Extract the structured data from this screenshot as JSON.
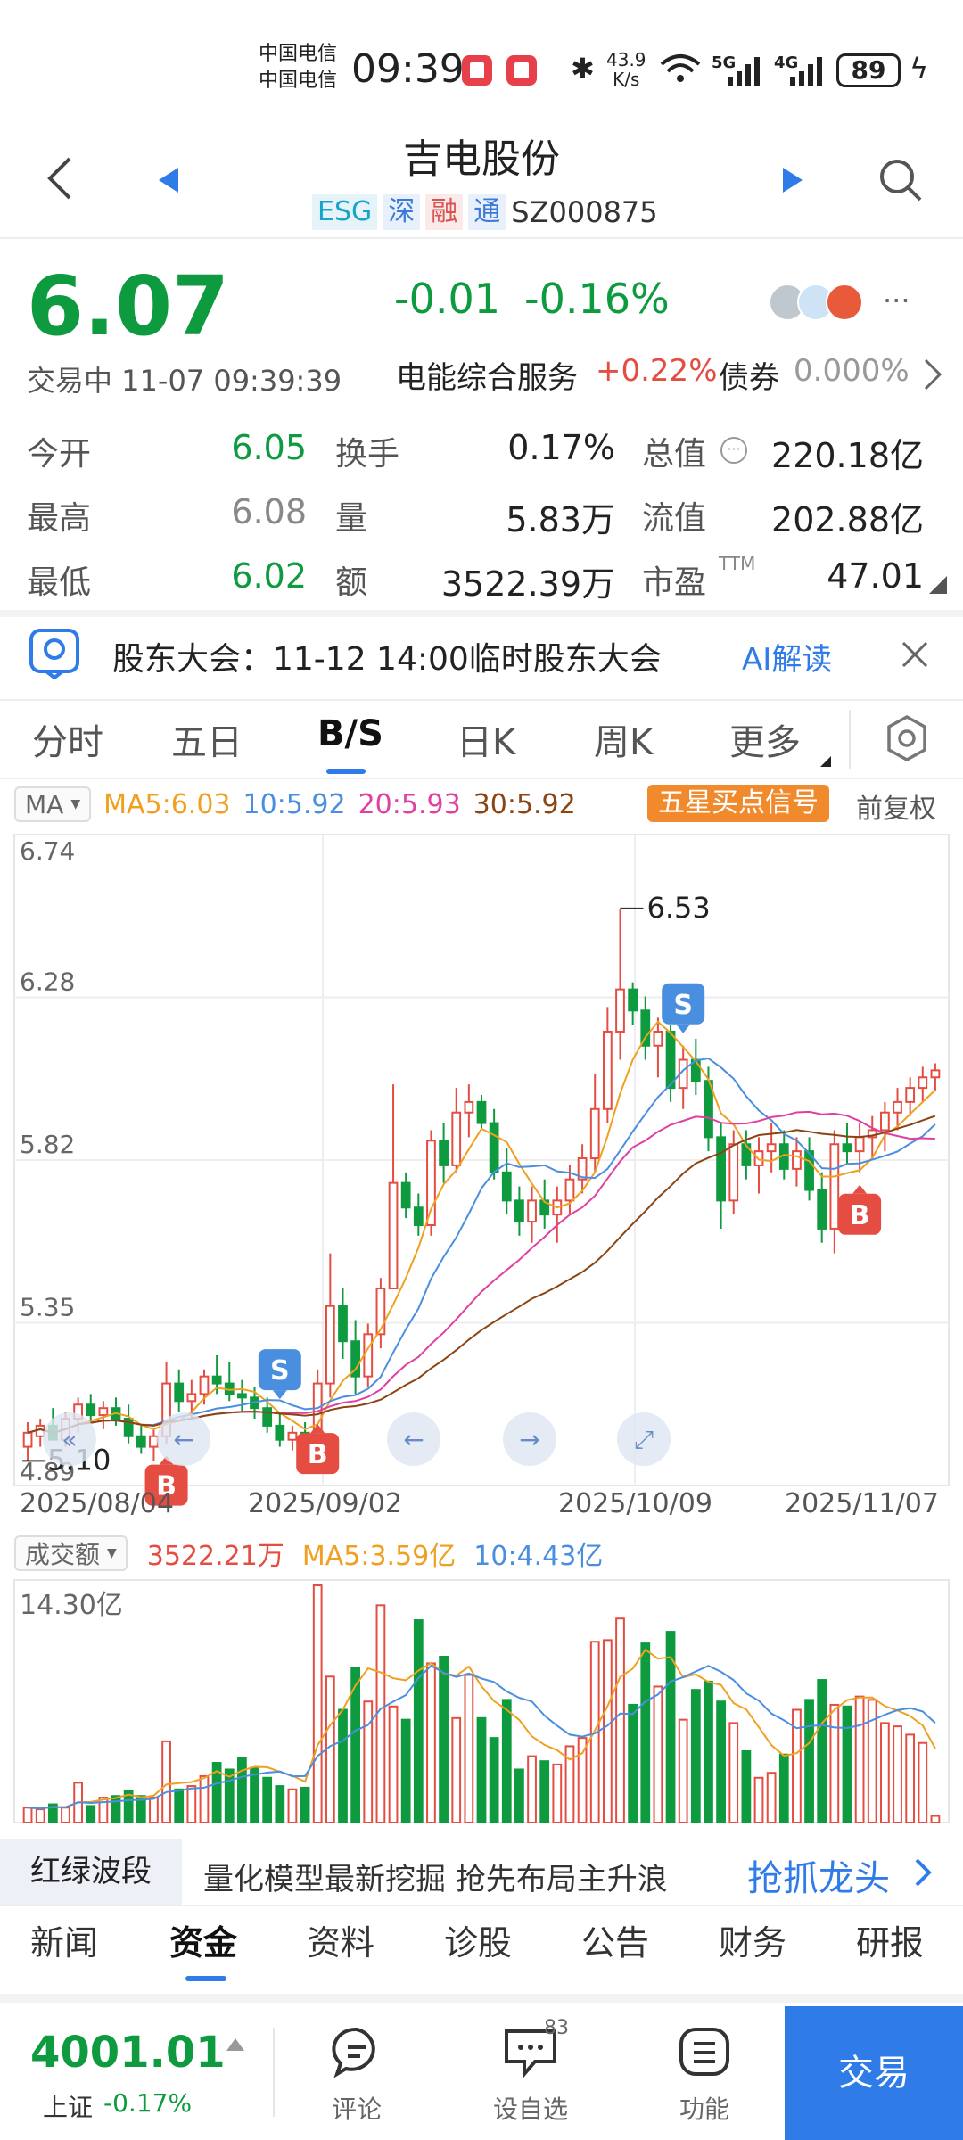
{
  "status": {
    "carrier1": "中国电信",
    "carrier2": "中国电信",
    "time": "09:39",
    "speed_value": "43.9",
    "speed_unit": "K/s",
    "net1": "5G",
    "net2": "4G",
    "battery": "89"
  },
  "header": {
    "title": "吉电股份",
    "tags": [
      "ESG",
      "深",
      "融",
      "通"
    ],
    "code": "SZ000875"
  },
  "quote": {
    "price": "6.07",
    "change": "-0.01",
    "change_pct": "-0.16%",
    "status_time": "交易中 11-07 09:39:39",
    "sector_name": "电能综合服务",
    "sector_pct": "+0.22%",
    "bond_label": "债券",
    "bond_pct": "0.000%",
    "more": "···"
  },
  "stats": [
    {
      "label": "今开",
      "value": "6.05",
      "color": "#0e9b3f"
    },
    {
      "label": "最高",
      "value": "6.08",
      "color": "#888888"
    },
    {
      "label": "最低",
      "value": "6.02",
      "color": "#0e9b3f"
    },
    {
      "label": "换手",
      "value": "0.17%",
      "color": "#222222"
    },
    {
      "label": "量",
      "value": "5.83万",
      "color": "#222222"
    },
    {
      "label": "额",
      "value": "3522.39万",
      "color": "#222222"
    },
    {
      "label": "总值",
      "value": "220.18亿",
      "color": "#222222"
    },
    {
      "label": "流值",
      "value": "202.88亿",
      "color": "#222222"
    },
    {
      "label": "市盈",
      "value": "47.01",
      "color": "#222222"
    }
  ],
  "pe_suffix": "TTM",
  "notice": {
    "text": "股东大会：11-12 14:00临时股东大会",
    "ai_label": "AI解读"
  },
  "chart_tabs": [
    "分时",
    "五日",
    "B/S",
    "日K",
    "周K",
    "更多"
  ],
  "ma_legend": {
    "selector": "MA",
    "ma5": "MA5:6.03",
    "ma10": "10:5.92",
    "ma20": "20:5.93",
    "ma30": "30:5.92",
    "signal_button": "五星买点信号",
    "adjust": "前复权"
  },
  "vol_legend": {
    "selector": "成交额",
    "value": "3522.21万",
    "ma5": "MA5:3.59亿",
    "ma10": "10:4.43亿",
    "max_label": "14.30亿"
  },
  "chart_data": {
    "type": "candlestick",
    "y_ticks": [
      "6.74",
      "6.28",
      "5.82",
      "5.35",
      "4.89"
    ],
    "ylim": [
      4.89,
      6.74
    ],
    "x_labels": [
      "2025/08/04",
      "2025/09/02",
      "2025/10/09",
      "2025/11/07"
    ],
    "annotations": {
      "high": "6.53",
      "low": "5.10"
    },
    "signals": [
      "B",
      "S",
      "B",
      "S",
      "B"
    ],
    "colors": {
      "up": "#e54d42",
      "down": "#0e9b3f",
      "ma5": "#f0a020",
      "ma10": "#4a8ee0",
      "ma20": "#e040a0",
      "ma30": "#8b4513"
    },
    "candles": [
      {
        "o": 5.0,
        "h": 5.07,
        "l": 4.96,
        "c": 5.04
      },
      {
        "o": 5.03,
        "h": 5.08,
        "l": 5.0,
        "c": 5.06
      },
      {
        "o": 5.06,
        "h": 5.11,
        "l": 5.02,
        "c": 5.02
      },
      {
        "o": 5.02,
        "h": 5.1,
        "l": 5.0,
        "c": 5.08
      },
      {
        "o": 5.08,
        "h": 5.14,
        "l": 5.04,
        "c": 5.12
      },
      {
        "o": 5.12,
        "h": 5.15,
        "l": 5.07,
        "c": 5.09
      },
      {
        "o": 5.09,
        "h": 5.13,
        "l": 5.05,
        "c": 5.11
      },
      {
        "o": 5.11,
        "h": 5.14,
        "l": 5.06,
        "c": 5.08
      },
      {
        "o": 5.08,
        "h": 5.12,
        "l": 5.01,
        "c": 5.03
      },
      {
        "o": 5.03,
        "h": 5.06,
        "l": 4.98,
        "c": 5.0
      },
      {
        "o": 5.0,
        "h": 5.05,
        "l": 4.96,
        "c": 5.03
      },
      {
        "o": 5.03,
        "h": 5.24,
        "l": 5.01,
        "c": 5.18
      },
      {
        "o": 5.18,
        "h": 5.22,
        "l": 5.1,
        "c": 5.13
      },
      {
        "o": 5.13,
        "h": 5.19,
        "l": 5.08,
        "c": 5.15
      },
      {
        "o": 5.15,
        "h": 5.22,
        "l": 5.12,
        "c": 5.2
      },
      {
        "o": 5.2,
        "h": 5.26,
        "l": 5.15,
        "c": 5.18
      },
      {
        "o": 5.18,
        "h": 5.24,
        "l": 5.13,
        "c": 5.15
      },
      {
        "o": 5.15,
        "h": 5.19,
        "l": 5.1,
        "c": 5.14
      },
      {
        "o": 5.14,
        "h": 5.17,
        "l": 5.08,
        "c": 5.11
      },
      {
        "o": 5.11,
        "h": 5.14,
        "l": 5.04,
        "c": 5.06
      },
      {
        "o": 5.06,
        "h": 5.1,
        "l": 5.0,
        "c": 5.02
      },
      {
        "o": 5.02,
        "h": 5.06,
        "l": 4.99,
        "c": 5.04
      },
      {
        "o": 5.04,
        "h": 5.07,
        "l": 5.0,
        "c": 5.02
      },
      {
        "o": 5.02,
        "h": 5.22,
        "l": 5.1,
        "c": 5.18
      },
      {
        "o": 5.18,
        "h": 5.55,
        "l": 5.14,
        "c": 5.4
      },
      {
        "o": 5.4,
        "h": 5.45,
        "l": 5.25,
        "c": 5.3
      },
      {
        "o": 5.3,
        "h": 5.36,
        "l": 5.15,
        "c": 5.2
      },
      {
        "o": 5.2,
        "h": 5.35,
        "l": 5.17,
        "c": 5.32
      },
      {
        "o": 5.32,
        "h": 5.48,
        "l": 5.28,
        "c": 5.45
      },
      {
        "o": 5.45,
        "h": 6.03,
        "l": 5.6,
        "c": 5.75
      },
      {
        "o": 5.75,
        "h": 5.78,
        "l": 5.65,
        "c": 5.68
      },
      {
        "o": 5.68,
        "h": 5.72,
        "l": 5.6,
        "c": 5.63
      },
      {
        "o": 5.63,
        "h": 5.9,
        "l": 5.6,
        "c": 5.87
      },
      {
        "o": 5.87,
        "h": 5.92,
        "l": 5.75,
        "c": 5.8
      },
      {
        "o": 5.8,
        "h": 6.02,
        "l": 5.78,
        "c": 5.95
      },
      {
        "o": 5.95,
        "h": 6.03,
        "l": 5.88,
        "c": 5.98
      },
      {
        "o": 5.98,
        "h": 6.0,
        "l": 5.9,
        "c": 5.92
      },
      {
        "o": 5.92,
        "h": 5.96,
        "l": 5.76,
        "c": 5.78
      },
      {
        "o": 5.78,
        "h": 5.85,
        "l": 5.66,
        "c": 5.7
      },
      {
        "o": 5.7,
        "h": 5.74,
        "l": 5.6,
        "c": 5.64
      },
      {
        "o": 5.64,
        "h": 5.74,
        "l": 5.58,
        "c": 5.7
      },
      {
        "o": 5.7,
        "h": 5.76,
        "l": 5.62,
        "c": 5.66
      },
      {
        "o": 5.66,
        "h": 5.74,
        "l": 5.58,
        "c": 5.7
      },
      {
        "o": 5.7,
        "h": 5.8,
        "l": 5.66,
        "c": 5.76
      },
      {
        "o": 5.76,
        "h": 5.86,
        "l": 5.72,
        "c": 5.82
      },
      {
        "o": 5.82,
        "h": 6.06,
        "l": 5.78,
        "c": 5.96
      },
      {
        "o": 5.96,
        "h": 6.25,
        "l": 5.92,
        "c": 6.18
      },
      {
        "o": 6.18,
        "h": 6.53,
        "l": 6.1,
        "c": 6.3
      },
      {
        "o": 6.3,
        "h": 6.32,
        "l": 6.2,
        "c": 6.24
      },
      {
        "o": 6.24,
        "h": 6.28,
        "l": 6.1,
        "c": 6.14
      },
      {
        "o": 6.14,
        "h": 6.22,
        "l": 6.05,
        "c": 6.18
      },
      {
        "o": 6.18,
        "h": 6.2,
        "l": 5.98,
        "c": 6.02
      },
      {
        "o": 6.02,
        "h": 6.14,
        "l": 5.96,
        "c": 6.1
      },
      {
        "o": 6.1,
        "h": 6.16,
        "l": 6.0,
        "c": 6.04
      },
      {
        "o": 6.04,
        "h": 6.08,
        "l": 5.84,
        "c": 5.88
      },
      {
        "o": 5.88,
        "h": 5.92,
        "l": 5.62,
        "c": 5.7
      },
      {
        "o": 5.7,
        "h": 5.9,
        "l": 5.66,
        "c": 5.86
      },
      {
        "o": 5.86,
        "h": 5.9,
        "l": 5.76,
        "c": 5.8
      },
      {
        "o": 5.8,
        "h": 5.88,
        "l": 5.72,
        "c": 5.84
      },
      {
        "o": 5.84,
        "h": 5.92,
        "l": 5.78,
        "c": 5.86
      },
      {
        "o": 5.86,
        "h": 5.9,
        "l": 5.76,
        "c": 5.79
      },
      {
        "o": 5.79,
        "h": 5.88,
        "l": 5.74,
        "c": 5.84
      },
      {
        "o": 5.84,
        "h": 5.88,
        "l": 5.7,
        "c": 5.73
      },
      {
        "o": 5.73,
        "h": 5.78,
        "l": 5.58,
        "c": 5.62
      },
      {
        "o": 5.62,
        "h": 5.9,
        "l": 5.55,
        "c": 5.86
      },
      {
        "o": 5.86,
        "h": 5.92,
        "l": 5.8,
        "c": 5.84
      },
      {
        "o": 5.84,
        "h": 5.92,
        "l": 5.78,
        "c": 5.88
      },
      {
        "o": 5.88,
        "h": 5.94,
        "l": 5.82,
        "c": 5.9
      },
      {
        "o": 5.9,
        "h": 5.98,
        "l": 5.84,
        "c": 5.95
      },
      {
        "o": 5.95,
        "h": 6.02,
        "l": 5.9,
        "c": 5.98
      },
      {
        "o": 5.98,
        "h": 6.05,
        "l": 5.94,
        "c": 6.02
      },
      {
        "o": 6.02,
        "h": 6.08,
        "l": 5.98,
        "c": 6.05
      },
      {
        "o": 6.05,
        "h": 6.09,
        "l": 6.01,
        "c": 6.07
      }
    ],
    "volume_series": [
      0.9,
      0.8,
      1.1,
      0.9,
      2.4,
      1.0,
      1.5,
      1.6,
      1.9,
      1.6,
      1.5,
      4.9,
      2.0,
      2.2,
      2.8,
      3.6,
      3.2,
      3.9,
      3.3,
      2.7,
      2.2,
      2.0,
      2.1,
      14.3,
      8.8,
      6.8,
      9.3,
      7.3,
      13.1,
      7.0,
      6.2,
      12.2,
      9.6,
      10.0,
      6.3,
      8.9,
      6.3,
      5.1,
      7.4,
      3.2,
      4.0,
      3.7,
      3.5,
      4.6,
      5.1,
      10.9,
      11.0,
      12.3,
      7.1,
      10.8,
      8.2,
      11.5,
      6.2,
      8.0,
      8.5,
      7.3,
      6.0,
      4.3,
      2.7,
      3.0,
      4.1,
      6.8,
      7.4,
      8.6,
      7.1,
      7.0,
      7.6,
      7.4,
      6.0,
      5.8,
      5.3,
      4.8,
      0.4
    ]
  },
  "promo": {
    "tag": "红绿波段",
    "text": "量化模型最新挖掘 抢先布局主升浪",
    "cta": "抢抓龙头"
  },
  "info_tabs": [
    "新闻",
    "资金",
    "资料",
    "诊股",
    "公告",
    "财务",
    "研报"
  ],
  "bottom": {
    "index_value": "4001.01",
    "index_name": "上证",
    "index_pct": "-0.17%",
    "comment": "评论",
    "watchlist": "设自选",
    "watchlist_badge": "83",
    "function": "功能",
    "trade": "交易"
  }
}
